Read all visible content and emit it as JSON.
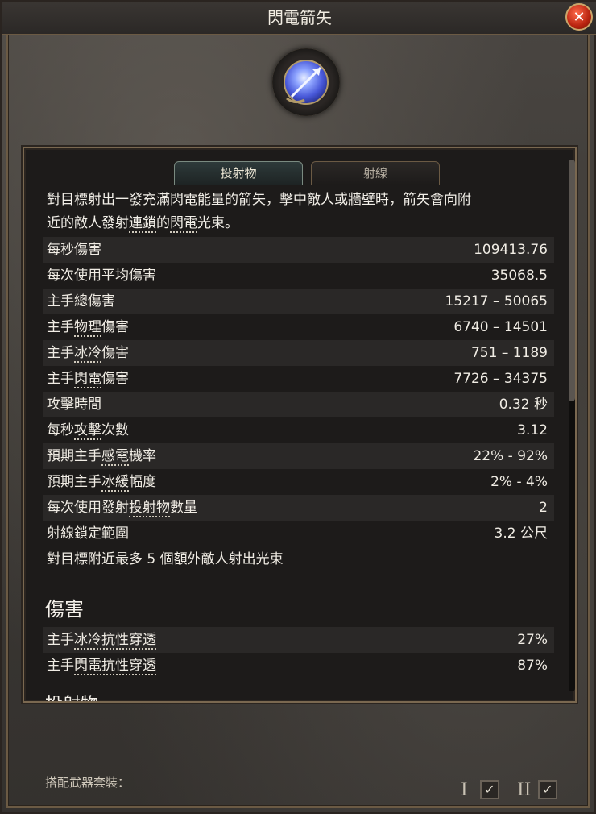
{
  "window": {
    "title": "閃電箭矢",
    "close_label": "✕"
  },
  "tabs": [
    {
      "label": "投射物",
      "active": true
    },
    {
      "label": "射線",
      "active": false
    }
  ],
  "description": {
    "line1": "對目標射出一發充滿閃電能量的箭矢，擊中敵人或牆壁時，箭矢會向附",
    "line2_pre": "近的敵人發射",
    "line2_link": "連鎖",
    "line2_mid": "的",
    "line2_link2": "閃電",
    "line2_post": "光束。"
  },
  "stats": [
    {
      "label_pre": "",
      "label_u": "",
      "label": "每秒傷害",
      "value": "109413.76"
    },
    {
      "label": "每次使用平均傷害",
      "value": "35068.5"
    },
    {
      "label": "主手總傷害",
      "value": "15217 – 50065"
    },
    {
      "label_pre": "主手",
      "label_u": "物理",
      "label_post": "傷害",
      "value": "6740 – 14501"
    },
    {
      "label_pre": "主手",
      "label_u": "冰冷",
      "label_post": "傷害",
      "value": "751 – 1189"
    },
    {
      "label_pre": "主手",
      "label_u": "閃電",
      "label_post": "傷害",
      "value": "7726 – 34375"
    },
    {
      "label": "攻擊時間",
      "value": "0.32 秒"
    },
    {
      "label_pre": "每秒",
      "label_u": "攻擊",
      "label_post": "次數",
      "value": "3.12"
    },
    {
      "label_pre": "預期主手",
      "label_u": "感電",
      "label_post": "機率",
      "value": "22% - 92%"
    },
    {
      "label_pre": "預期主手",
      "label_u": "冰緩",
      "label_post": "幅度",
      "value": "2% - 4%"
    },
    {
      "label_pre": "每次使用發射",
      "label_u": "投射物",
      "label_post": "數量",
      "value": "2"
    },
    {
      "label": "射線鎖定範圍",
      "value": "3.2 公尺"
    },
    {
      "label": "對目標附近最多 5 個額外敵人射出光束",
      "value": ""
    }
  ],
  "damage_section": {
    "title": "傷害",
    "rows": [
      {
        "label_pre": "主手",
        "label_u": "冰冷抗性穿透",
        "value": "27%"
      },
      {
        "label_pre": "主手",
        "label_u": "閃電抗性穿透",
        "value": "87%"
      }
    ],
    "next_section_partial": "投射物"
  },
  "footer": {
    "weapon_set_label": "搭配武器套裝：",
    "set1": "I",
    "set2": "II",
    "check_mark": "✓"
  },
  "colors": {
    "accent_gold": "#6b5a44",
    "close_red": "#b8230f",
    "orb_blue": "#4858d8"
  }
}
